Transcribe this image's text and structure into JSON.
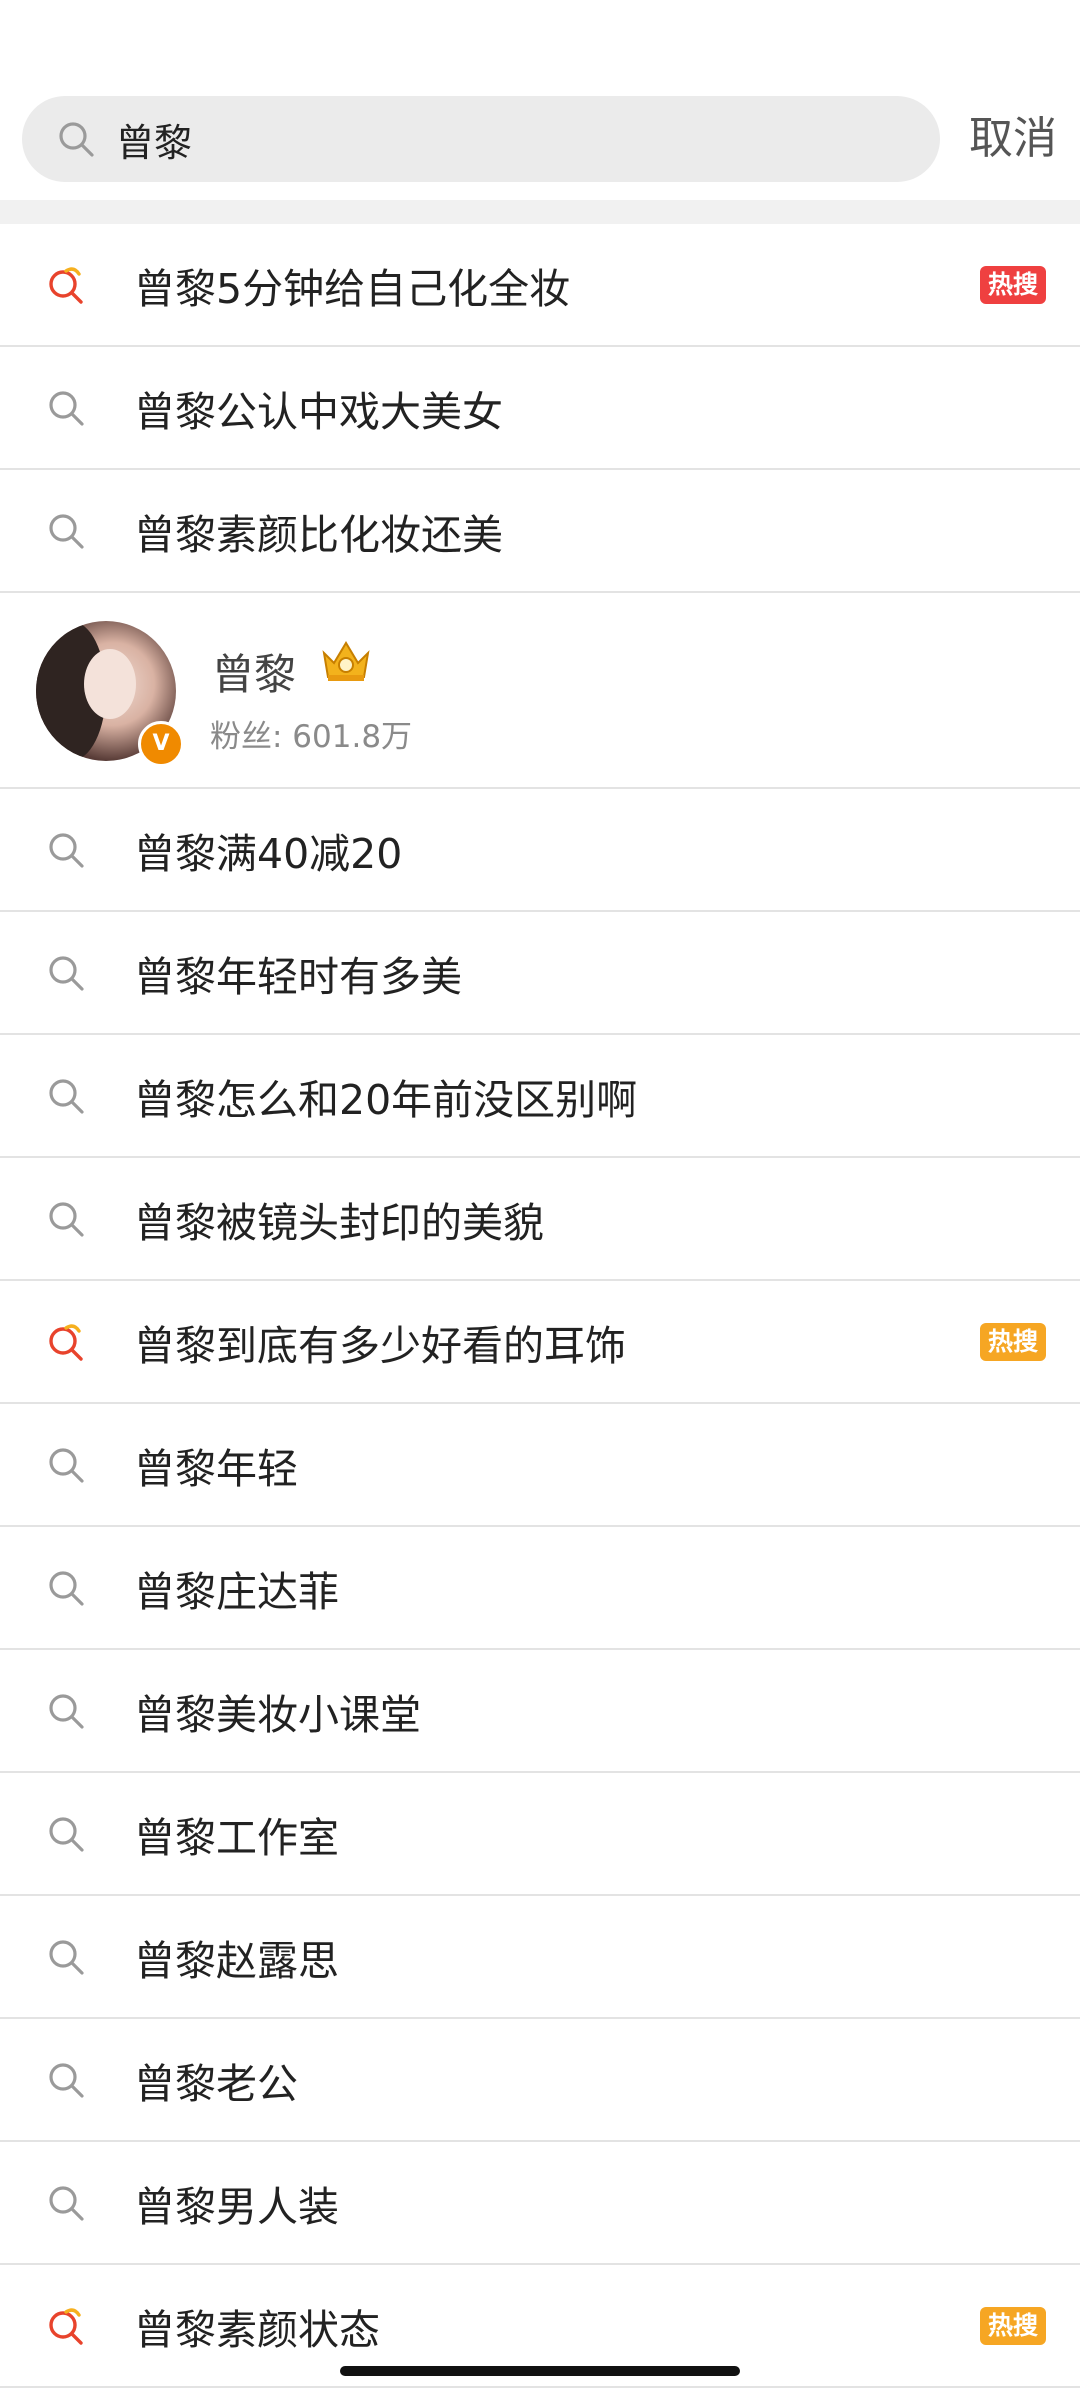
{
  "search": {
    "value": "曾黎"
  },
  "cancel_label": "取消",
  "suggestions_top": [
    {
      "text": "曾黎5分钟给自己化全妆",
      "hot": true,
      "badge": "热搜",
      "badge_color": "#ef4040"
    },
    {
      "text": "曾黎公认中戏大美女",
      "hot": false
    },
    {
      "text": "曾黎素颜比化妆还美",
      "hot": false
    }
  ],
  "user": {
    "name": "曾黎",
    "followers": "粉丝: 601.8万",
    "verified_mark": "V"
  },
  "suggestions_bottom": [
    {
      "text": "曾黎满40减20",
      "hot": false
    },
    {
      "text": "曾黎年轻时有多美",
      "hot": false
    },
    {
      "text": "曾黎怎么和20年前没区别啊",
      "hot": false
    },
    {
      "text": "曾黎被镜头封印的美貌",
      "hot": false
    },
    {
      "text": "曾黎到底有多少好看的耳饰",
      "hot": true,
      "badge": "热搜",
      "badge_color": "#f6a623"
    },
    {
      "text": "曾黎年轻",
      "hot": false
    },
    {
      "text": "曾黎庄达菲",
      "hot": false
    },
    {
      "text": "曾黎美妆小课堂",
      "hot": false
    },
    {
      "text": "曾黎工作室",
      "hot": false
    },
    {
      "text": "曾黎赵露思",
      "hot": false
    },
    {
      "text": "曾黎老公",
      "hot": false
    },
    {
      "text": "曾黎男人装",
      "hot": false
    },
    {
      "text": "曾黎素颜状态",
      "hot": true,
      "badge": "热搜",
      "badge_color": "#f6a623"
    }
  ],
  "colors": {
    "hot_icon": "#e8432c",
    "hot_icon_accent": "#f6b01e",
    "search_icon": "#9a9a9a"
  }
}
